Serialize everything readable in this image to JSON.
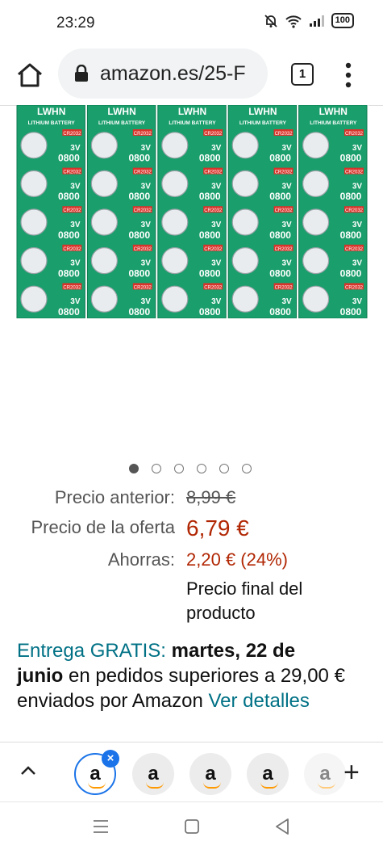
{
  "status": {
    "time": "23:29",
    "battery": "100"
  },
  "browser": {
    "url": "amazon.es/25-F",
    "tab_count": "1"
  },
  "product": {
    "brand": "LWHN",
    "tagline": "LITHIUM BATTERY",
    "model": "CR2032",
    "voltage": "3V",
    "code": "0800",
    "grid_rows": 5,
    "grid_cols": 5
  },
  "carousel": {
    "count": 6,
    "active_index": 0
  },
  "pricing": {
    "old_label": "Precio anterior:",
    "old_price": "8,99 €",
    "deal_label": "Precio de la oferta",
    "deal_price": "6,79 €",
    "save_label": "Ahorras:",
    "savings": "2,20 € (24%)",
    "final_note_1": "Precio final del",
    "final_note_2": "producto"
  },
  "delivery": {
    "free_label": "Entrega GRATIS:",
    "date_part1": "martes, 22 de",
    "date_part2": "junio",
    "condition": " en pedidos superiores a 29,00 € enviados por Amazon ",
    "details_link": "Ver detalles"
  },
  "tabstrip": {
    "tabs": [
      "a",
      "a",
      "a",
      "a",
      "a"
    ],
    "close_symbol": "×",
    "add_symbol": "+"
  },
  "colors": {
    "accent_red": "#b12704",
    "link_teal": "#007185",
    "chip_green": "#1a9e6c",
    "model_red": "#d9342b"
  }
}
